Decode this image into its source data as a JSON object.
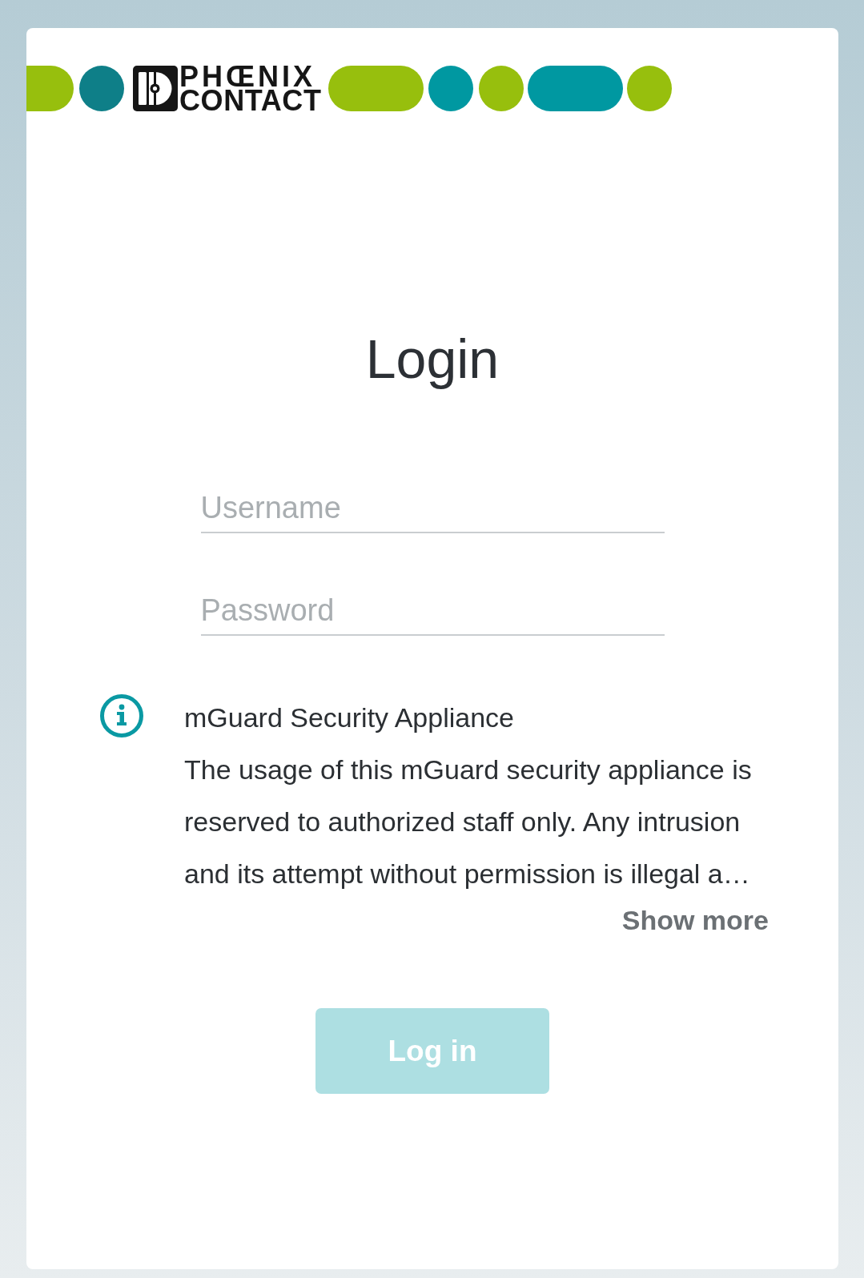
{
  "brand": {
    "wordmark": [
      "PHŒNIX",
      "CONTACT"
    ]
  },
  "title": "Login",
  "fields": [
    {
      "placeholder": "Username"
    },
    {
      "placeholder": "Password"
    }
  ],
  "notice": {
    "title": "mGuard Security Appliance",
    "message": "The usage of this mGuard security appliance is reserved to authorized staff only. Any intrusion and its attempt without permission is illegal a…",
    "toggle": "Show more"
  },
  "login_button": {
    "label": "Log in",
    "disabled": true
  }
}
